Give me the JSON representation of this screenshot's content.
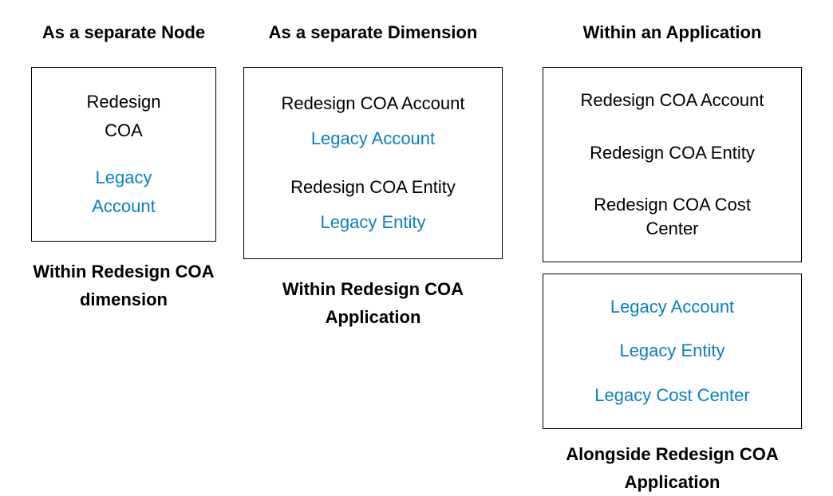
{
  "columns": [
    {
      "header": "As a separate Node",
      "boxes": [
        {
          "items": [
            {
              "text": "Redesign",
              "highlight": false
            },
            {
              "text": "COA",
              "highlight": false
            },
            {
              "spacer": true
            },
            {
              "text": "Legacy",
              "highlight": true
            },
            {
              "text": "Account",
              "highlight": true
            }
          ]
        }
      ],
      "caption": "Within Redesign COA  dimension"
    },
    {
      "header": "As a separate Dimension",
      "boxes": [
        {
          "groups": [
            [
              {
                "text": "Redesign COA Account",
                "highlight": false
              },
              {
                "text": "Legacy Account",
                "highlight": true
              }
            ],
            [
              {
                "text": "Redesign COA Entity",
                "highlight": false
              },
              {
                "text": "Legacy Entity",
                "highlight": true
              }
            ]
          ]
        }
      ],
      "caption": "Within Redesign COA Application"
    },
    {
      "header": "Within an Application",
      "boxes": [
        {
          "groups": [
            [
              {
                "text": "Redesign COA Account",
                "highlight": false
              }
            ],
            [
              {
                "text": "Redesign COA Entity",
                "highlight": false
              }
            ],
            [
              {
                "text": "Redesign COA Cost Center",
                "highlight": false
              }
            ]
          ]
        },
        {
          "groups": [
            [
              {
                "text": "Legacy Account",
                "highlight": true
              }
            ],
            [
              {
                "text": "Legacy Entity",
                "highlight": true
              }
            ],
            [
              {
                "text": "Legacy Cost Center",
                "highlight": true
              }
            ]
          ]
        }
      ],
      "caption": "Alongside Redesign COA Application"
    }
  ]
}
